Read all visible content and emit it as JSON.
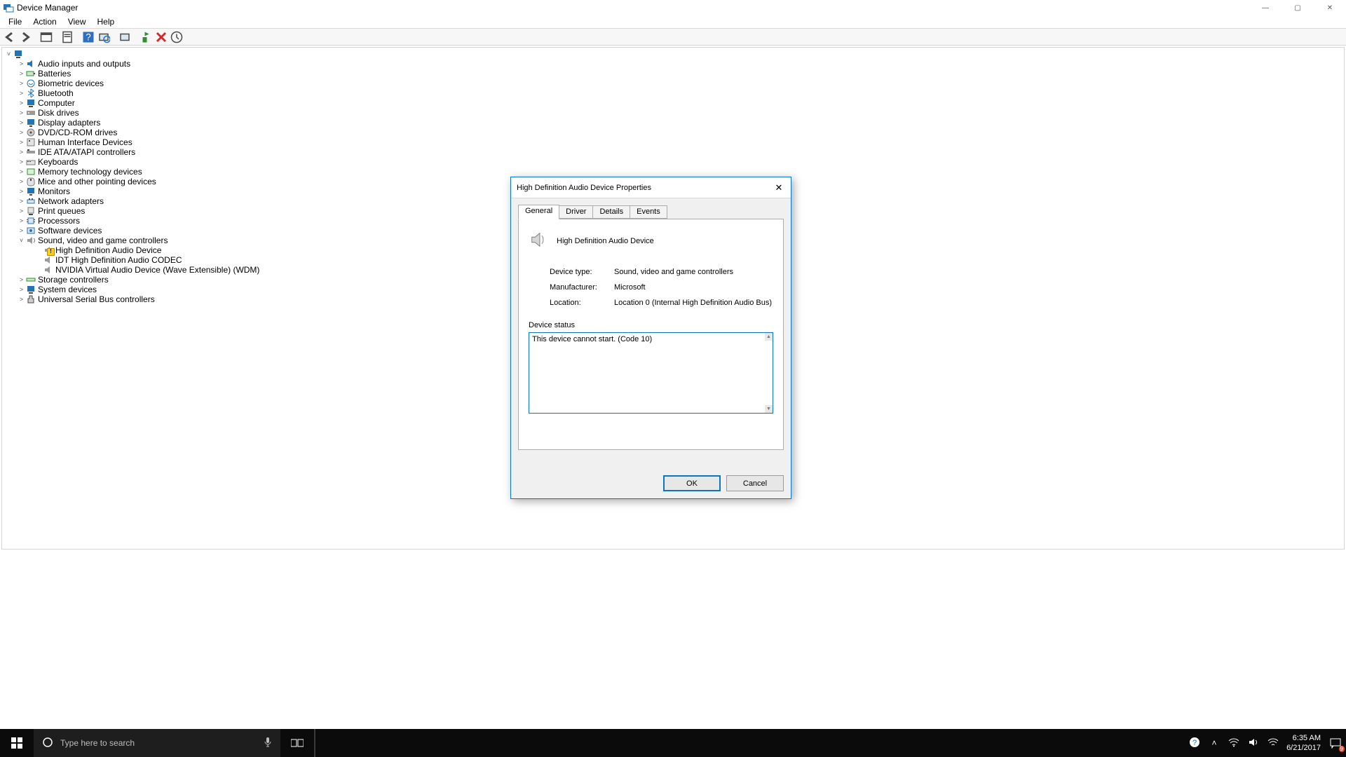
{
  "dm": {
    "title": "Device Manager",
    "menu": [
      "File",
      "Action",
      "View",
      "Help"
    ],
    "root": "",
    "categories": [
      "Audio inputs and outputs",
      "Batteries",
      "Biometric devices",
      "Bluetooth",
      "Computer",
      "Disk drives",
      "Display adapters",
      "DVD/CD-ROM drives",
      "Human Interface Devices",
      "IDE ATA/ATAPI controllers",
      "Keyboards",
      "Memory technology devices",
      "Mice and other pointing devices",
      "Monitors",
      "Network adapters",
      "Print queues",
      "Processors",
      "Software devices",
      "Sound, video and game controllers",
      "Storage controllers",
      "System devices",
      "Universal Serial Bus controllers"
    ],
    "sound_children": [
      "High Definition Audio Device",
      "IDT High Definition Audio CODEC",
      "NVIDIA Virtual Audio Device (Wave Extensible) (WDM)"
    ]
  },
  "dlg": {
    "title": "High Definition Audio Device Properties",
    "tabs": [
      "General",
      "Driver",
      "Details",
      "Events"
    ],
    "device_name": "High Definition Audio Device",
    "rows": {
      "type_lbl": "Device type:",
      "type_val": "Sound, video and game controllers",
      "manu_lbl": "Manufacturer:",
      "manu_val": "Microsoft",
      "loc_lbl": "Location:",
      "loc_val": "Location 0 (Internal High Definition Audio Bus)"
    },
    "status_lbl": "Device status",
    "status_txt": "This device cannot start. (Code 10)",
    "ok": "OK",
    "cancel": "Cancel"
  },
  "taskbar": {
    "search_placeholder": "Type here to search",
    "time": "6:35 AM",
    "date": "6/21/2017",
    "notif_count": "9"
  }
}
